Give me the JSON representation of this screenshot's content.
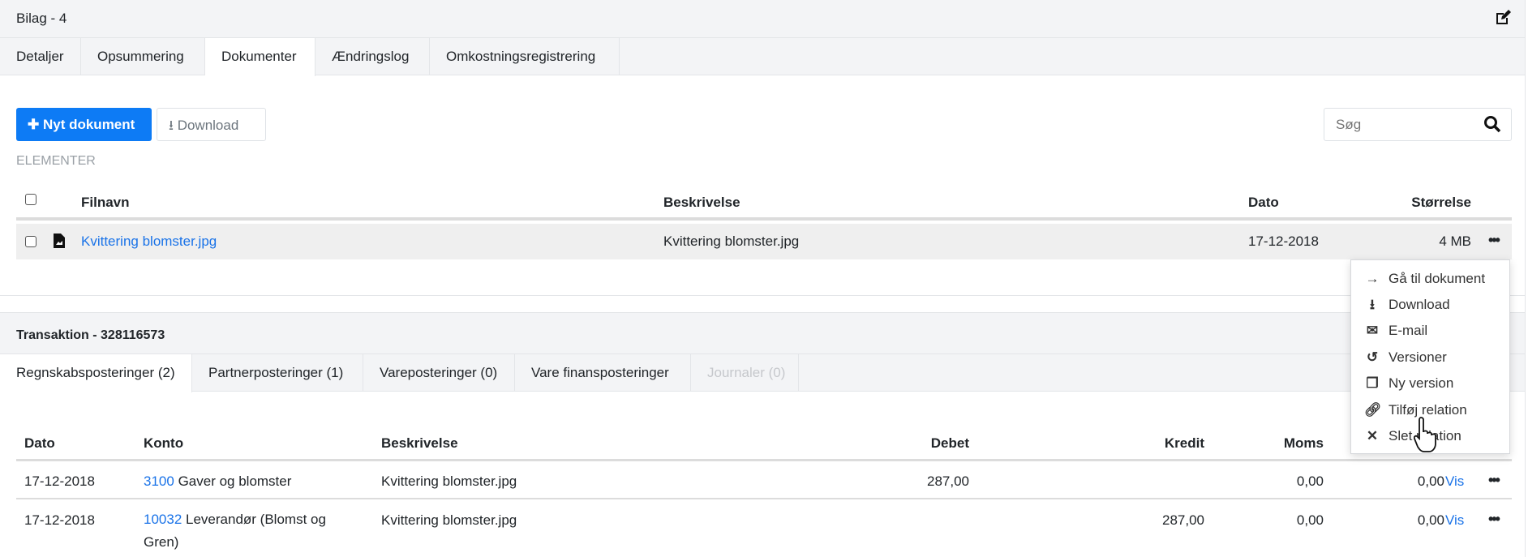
{
  "header": {
    "title": "Bilag - 4",
    "edit_icon": "edit-icon"
  },
  "tabs": [
    {
      "label": "Detaljer"
    },
    {
      "label": "Opsummering"
    },
    {
      "label": "Dokumenter",
      "active": true
    },
    {
      "label": "Ændringslog"
    },
    {
      "label": "Omkostningsregistrering"
    }
  ],
  "toolbar": {
    "new_label": "Nyt dokument",
    "download_label": "Download",
    "search_placeholder": "Søg"
  },
  "section_label": "ELEMENTER",
  "documents": {
    "columns": [
      "Filnavn",
      "Beskrivelse",
      "Dato",
      "Størrelse"
    ],
    "rows": [
      {
        "filename": "Kvittering blomster.jpg",
        "description": "Kvittering blomster.jpg",
        "date": "17-12-2018",
        "size": "4 MB"
      }
    ]
  },
  "context_menu": [
    {
      "icon": "arrow-right-icon",
      "label": "Gå til dokument"
    },
    {
      "icon": "download-icon",
      "label": "Download"
    },
    {
      "icon": "envelope-icon",
      "label": "E-mail"
    },
    {
      "icon": "history-icon",
      "label": "Versioner"
    },
    {
      "icon": "copy-icon",
      "label": "Ny version"
    },
    {
      "icon": "link-icon",
      "label": "Tilføj relation"
    },
    {
      "icon": "close-icon",
      "label": "Slet relation"
    }
  ],
  "transaction": {
    "title": "Transaktion - 328116573",
    "tabs": [
      {
        "label": "Regnskabsposteringer (2)",
        "active": true
      },
      {
        "label": "Partnerposteringer (1)"
      },
      {
        "label": "Vareposteringer (0)"
      },
      {
        "label": "Vare finansposteringer"
      },
      {
        "label": "Journaler (0)",
        "disabled": true
      }
    ],
    "columns": [
      "Dato",
      "Konto",
      "Beskrivelse",
      "Debet",
      "Kredit",
      "Moms"
    ],
    "rows": [
      {
        "date": "17-12-2018",
        "account_no": "3100",
        "account_name": "Gaver og blomster",
        "description": "Kvittering blomster.jpg",
        "debet": "287,00",
        "kredit": "",
        "moms": "0,00",
        "extra": "0,00",
        "view": "Vis"
      },
      {
        "date": "17-12-2018",
        "account_no": "10032",
        "account_name": "Leverandør (Blomst og Gren)",
        "description": "Kvittering blomster.jpg",
        "debet": "",
        "kredit": "287,00",
        "moms": "0,00",
        "extra": "0,00",
        "view": "Vis"
      }
    ]
  },
  "colors": {
    "primary": "#0d7bf5",
    "link": "#1a73e8",
    "header_bg": "#f3f4f6",
    "row_hover": "#efefef"
  }
}
